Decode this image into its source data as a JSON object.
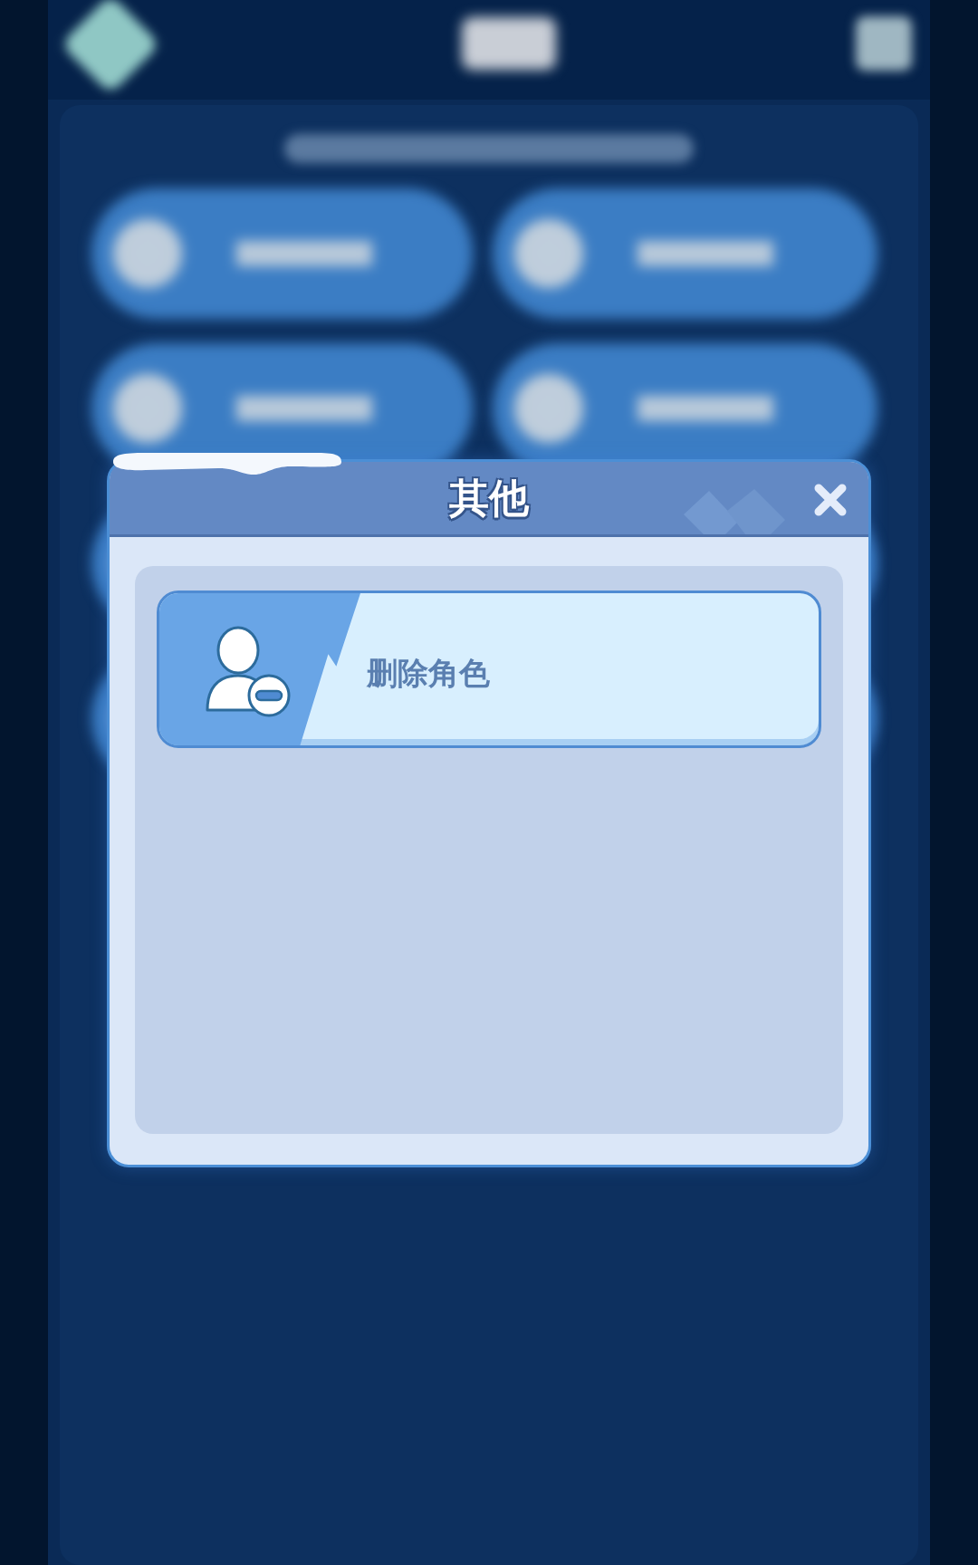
{
  "dialog": {
    "title": "其他",
    "items": [
      {
        "label": "删除角色"
      }
    ]
  }
}
